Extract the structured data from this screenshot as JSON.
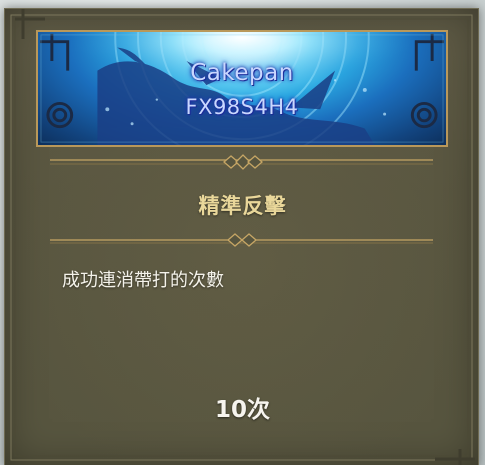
{
  "player": {
    "name": "Cakepan",
    "code": "FX98S4H4"
  },
  "achievement": {
    "title": "精準反擊",
    "description": "成功連消帶打的次數",
    "value": "10次"
  },
  "colors": {
    "panel": "#5a5741",
    "gold_accent": "#c6a665",
    "title_text": "#e9d79a",
    "name_text": "#c9d7ff",
    "banner_blue": "#1b6fbe"
  },
  "icons": [
    "ornate-frame-corner-icon",
    "diamond-ornament-icon",
    "dragon-silhouette-icon"
  ]
}
